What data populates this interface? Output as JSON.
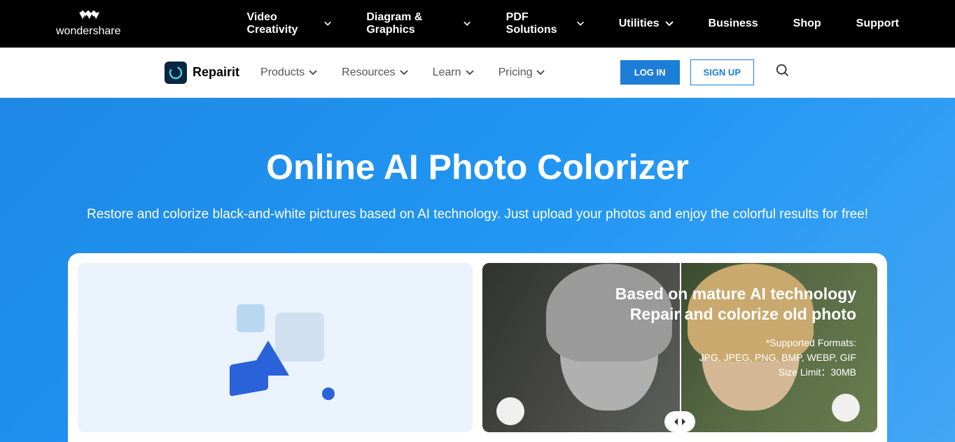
{
  "topNav": {
    "brand": "wondershare",
    "items": [
      {
        "label": "Video Creativity",
        "hasDropdown": true
      },
      {
        "label": "Diagram & Graphics",
        "hasDropdown": true
      },
      {
        "label": "PDF Solutions",
        "hasDropdown": true
      },
      {
        "label": "Utilities",
        "hasDropdown": true
      },
      {
        "label": "Business",
        "hasDropdown": false
      },
      {
        "label": "Shop",
        "hasDropdown": false
      },
      {
        "label": "Support",
        "hasDropdown": false
      }
    ]
  },
  "subNav": {
    "product": "Repairit",
    "items": [
      {
        "label": "Products"
      },
      {
        "label": "Resources"
      },
      {
        "label": "Learn"
      },
      {
        "label": "Pricing"
      }
    ],
    "login": "LOG IN",
    "signup": "SIGN UP"
  },
  "hero": {
    "title": "Online AI Photo Colorizer",
    "subtitle": "Restore and colorize black-and-white pictures based on AI technology. Just upload your photos and enjoy the colorful results for free!"
  },
  "cardRight": {
    "line1": "Based on mature AI technology",
    "line2": "Repair and colorize old photo",
    "formatsLabel": "*Supported Formats:",
    "formats": "JPG, JPEG, PNG, BMP, WEBP, GIF",
    "sizeLimit": "Size Limit：30MB"
  }
}
